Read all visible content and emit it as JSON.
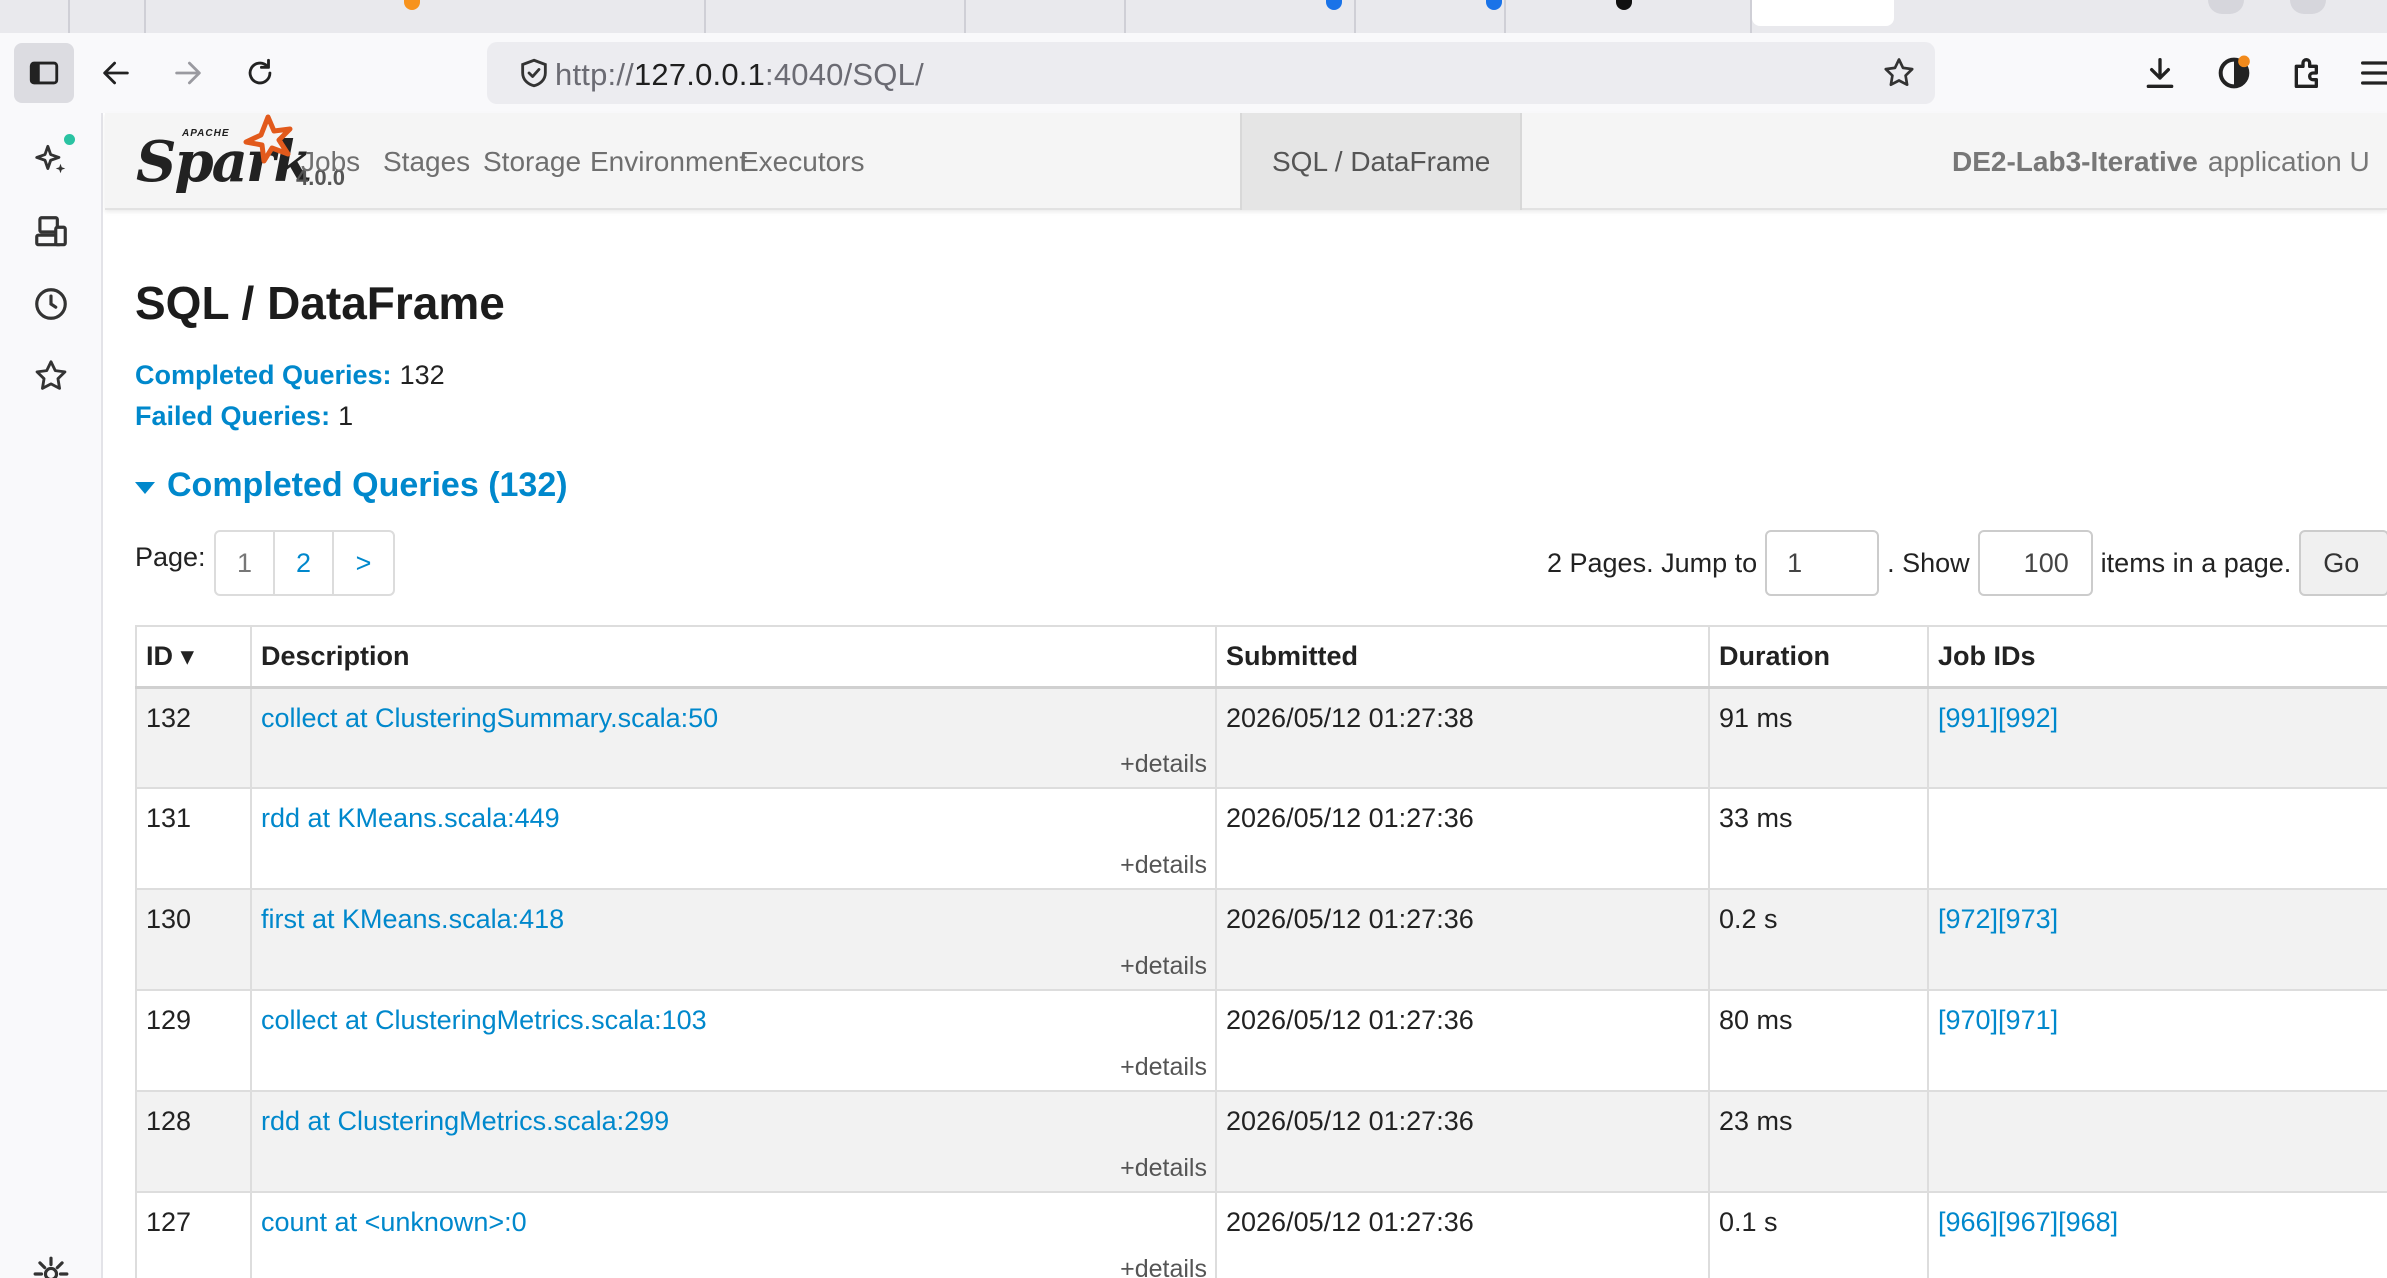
{
  "browser": {
    "url_prefix": "http://",
    "url_host": "127.0.0.1",
    "url_rest": ":4040/SQL/"
  },
  "spark": {
    "apache_label": "APACHE",
    "logo_text": "Spark",
    "version": "4.0.0",
    "tabs": [
      {
        "label": "Jobs",
        "active": false
      },
      {
        "label": "Stages",
        "active": false
      },
      {
        "label": "Storage",
        "active": false
      },
      {
        "label": "Environment",
        "active": false
      },
      {
        "label": "Executors",
        "active": false
      },
      {
        "label": "SQL / DataFrame",
        "active": true
      }
    ],
    "app_name": "DE2-Lab3-Iterative",
    "app_suffix": "application U"
  },
  "page": {
    "title": "SQL / DataFrame",
    "completed_label": "Completed Queries:",
    "completed_count": "132",
    "failed_label": "Failed Queries:",
    "failed_count": "1",
    "section_title": "Completed Queries (132)",
    "pager_label": "Page:",
    "pages": [
      "1",
      "2",
      ">"
    ],
    "pages_text": "2 Pages. Jump to",
    "jump_value": "1",
    "show_text": ". Show",
    "page_size": "100",
    "items_text": "items in a page.",
    "go_label": "Go"
  },
  "table": {
    "headers": [
      "ID ▾",
      "Description",
      "Submitted",
      "Duration",
      "Job IDs"
    ],
    "details_label": "+details",
    "rows": [
      {
        "id": "132",
        "desc": "collect at ClusteringSummary.scala:50",
        "submitted": "2026/05/12 01:27:38",
        "duration": "91 ms",
        "jobs": "[991][992]"
      },
      {
        "id": "131",
        "desc": "rdd at KMeans.scala:449",
        "submitted": "2026/05/12 01:27:36",
        "duration": "33 ms",
        "jobs": ""
      },
      {
        "id": "130",
        "desc": "first at KMeans.scala:418",
        "submitted": "2026/05/12 01:27:36",
        "duration": "0.2 s",
        "jobs": "[972][973]"
      },
      {
        "id": "129",
        "desc": "collect at ClusteringMetrics.scala:103",
        "submitted": "2026/05/12 01:27:36",
        "duration": "80 ms",
        "jobs": "[970][971]"
      },
      {
        "id": "128",
        "desc": "rdd at ClusteringMetrics.scala:299",
        "submitted": "2026/05/12 01:27:36",
        "duration": "23 ms",
        "jobs": ""
      },
      {
        "id": "127",
        "desc": "count at <unknown>:0",
        "submitted": "2026/05/12 01:27:36",
        "duration": "0.1 s",
        "jobs": "[966][967][968]"
      }
    ]
  }
}
